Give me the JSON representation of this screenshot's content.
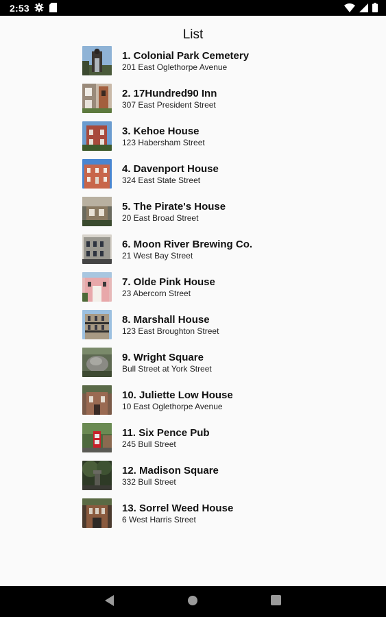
{
  "status_bar": {
    "time": "2:53",
    "icons": [
      "settings-icon",
      "sd-card-icon",
      "wifi-icon",
      "signal-icon",
      "battery-icon"
    ]
  },
  "app": {
    "title": "List"
  },
  "items": [
    {
      "title": "1. Colonial Park Cemetery",
      "address": "201 East Oglethorpe Avenue"
    },
    {
      "title": "2. 17Hundred90 Inn",
      "address": "307 East President Street"
    },
    {
      "title": "3. Kehoe House",
      "address": "123 Habersham Street"
    },
    {
      "title": "4. Davenport House",
      "address": "324 East State Street"
    },
    {
      "title": "5. The Pirate's House",
      "address": "20 East Broad Street"
    },
    {
      "title": "6. Moon River Brewing Co.",
      "address": "21 West Bay Street"
    },
    {
      "title": "7. Olde Pink House",
      "address": "23 Abercorn Street"
    },
    {
      "title": "8. Marshall House",
      "address": "123 East Broughton Street"
    },
    {
      "title": "9. Wright Square",
      "address": "Bull Street at York Street"
    },
    {
      "title": "10. Juliette Low House",
      "address": "10 East Oglethorpe Avenue"
    },
    {
      "title": "11. Six Pence Pub",
      "address": "245 Bull Street"
    },
    {
      "title": "12. Madison Square",
      "address": "332 Bull Street"
    },
    {
      "title": "13. Sorrel Weed House",
      "address": "6 West Harris Street"
    }
  ],
  "nav_bar": {
    "icons": [
      "back-icon",
      "home-icon",
      "recents-icon"
    ]
  },
  "colors": {
    "status_bar_bg": "#000000",
    "page_bg": "#fafafa",
    "text": "#111111"
  }
}
